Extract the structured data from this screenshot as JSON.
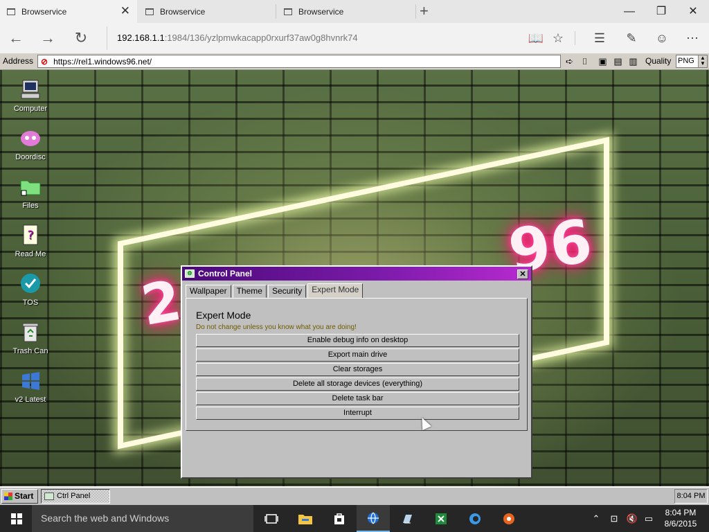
{
  "browser": {
    "tabs": [
      {
        "title": "Browservice",
        "active": true
      },
      {
        "title": "Browservice",
        "active": false
      },
      {
        "title": "Browservice",
        "active": false
      }
    ],
    "url_host": "192.168.1.1",
    "url_path": ":1984/136/yzlpmwkacapp0rxurf37aw0g8hvnrk74"
  },
  "browservice_bar": {
    "address_label": "Address",
    "address_value": "https://rel1.windows96.net/",
    "quality_label": "Quality",
    "quality_value": "PNG"
  },
  "desktop": {
    "icons": [
      {
        "label": "Computer",
        "icon": "computer-icon"
      },
      {
        "label": "Doordisc",
        "icon": "doordisc-icon"
      },
      {
        "label": "Files",
        "icon": "folder-icon"
      },
      {
        "label": "Read Me",
        "icon": "readme-icon"
      },
      {
        "label": "TOS",
        "icon": "tos-check-icon"
      },
      {
        "label": "Trash Can",
        "icon": "trash-can-icon"
      },
      {
        "label": "v2 Latest",
        "icon": "v2-latest-icon"
      }
    ],
    "neon_text": "96"
  },
  "control_panel": {
    "title": "Control Panel",
    "tabs": [
      "Wallpaper",
      "Theme",
      "Security",
      "Expert Mode"
    ],
    "selected_tab": "Expert Mode",
    "heading": "Expert Mode",
    "warning": "Do not change unless you know what you are doing!",
    "buttons": [
      "Enable debug info on desktop",
      "Export main drive",
      "Clear storages",
      "Delete all storage devices (everything)",
      "Delete task bar",
      "Interrupt"
    ],
    "colors": {
      "title_start": "#4b0a7a",
      "title_end": "#b82ad0",
      "warning": "#6e5a00"
    }
  },
  "w96_taskbar": {
    "start_label": "Start",
    "task_label": "Ctrl Panel",
    "clock": "8:04 PM"
  },
  "win10_taskbar": {
    "search_placeholder": "Search the web and Windows",
    "time": "8:04 PM",
    "date": "8/6/2015",
    "accent": "#76b9ed"
  }
}
